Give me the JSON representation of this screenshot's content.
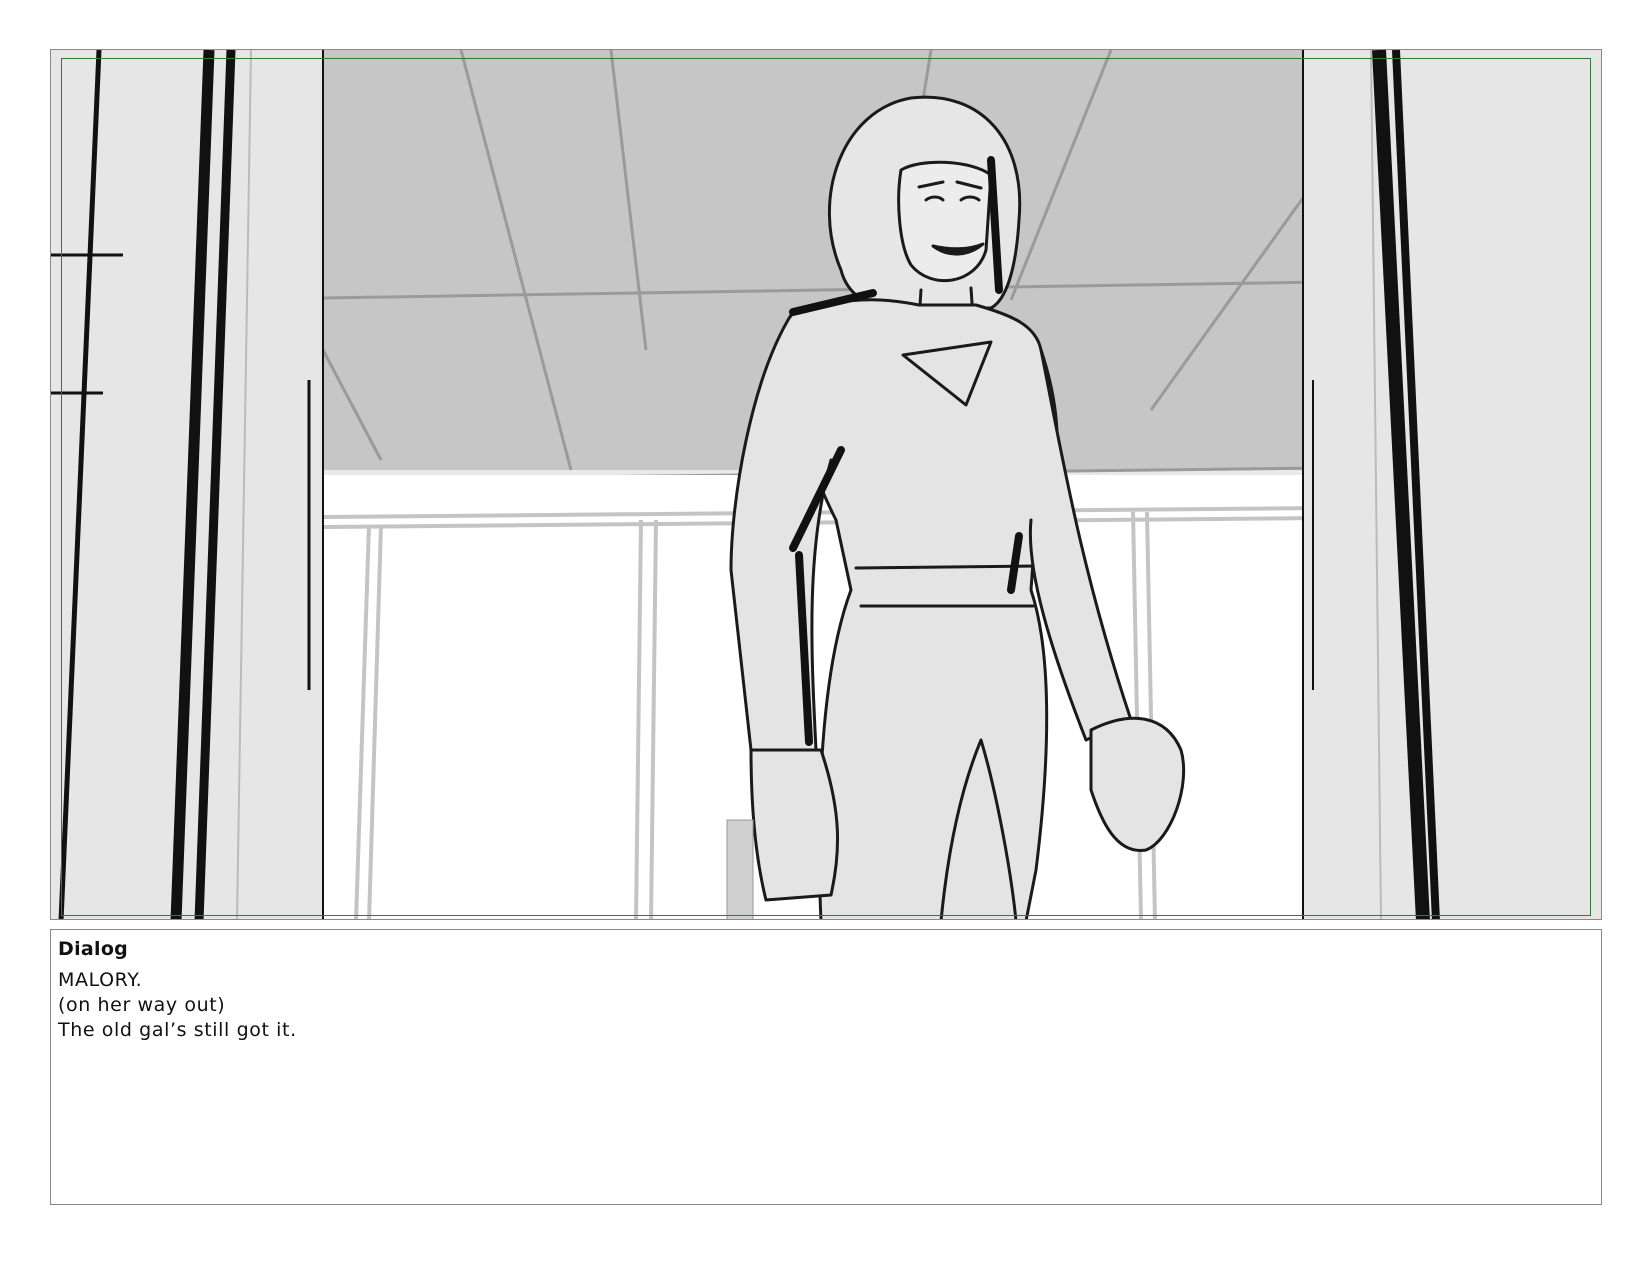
{
  "panel": {
    "frame_color": "#2e7d32",
    "description_icon": "storyboard-sketch-image"
  },
  "dialog": {
    "heading": "Dialog",
    "lines": [
      "MALORY.",
      "(on her way out)",
      "The old gal’s still got it."
    ]
  }
}
